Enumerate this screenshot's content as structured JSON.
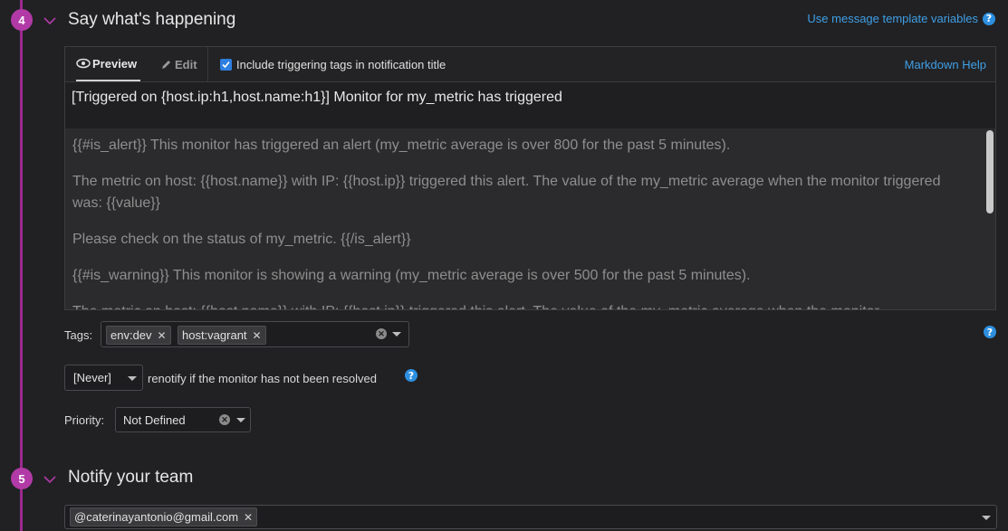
{
  "steps": [
    {
      "number": "4",
      "title": "Say what's happening"
    },
    {
      "number": "5",
      "title": "Notify your team"
    }
  ],
  "template_link": "Use message template variables",
  "editor": {
    "tabs": {
      "preview": "Preview",
      "edit": "Edit"
    },
    "include_tags_label": "Include triggering tags in notification title",
    "include_tags_checked": true,
    "markdown_help": "Markdown Help",
    "title_text": "[Triggered on {host.ip:h1,host.name:h1}] Monitor for my_metric has triggered",
    "body": [
      "{{#is_alert}} This monitor has triggered an alert (my_metric average is over 800 for the past 5 minutes).",
      "The metric on host: {{host.name}} with IP: {{host.ip}} triggered this alert. The value of the my_metric average when the monitor triggered was: {{value}}",
      "Please check on the status of my_metric. {{/is_alert}}",
      "{{#is_warning}} This monitor is showing a warning (my_metric average is over 500 for the past 5 minutes).",
      "The metric on host: {{host.name}} with IP: {{host.ip}} triggered this alert. The value of the my_metric average when the monitor"
    ]
  },
  "tags": {
    "label": "Tags:",
    "items": [
      "env:dev",
      "host:vagrant"
    ]
  },
  "renotify": {
    "value": "[Never]",
    "label": "renotify if the monitor has not been resolved"
  },
  "priority": {
    "label": "Priority:",
    "value": "Not Defined"
  },
  "notify": {
    "recipients": [
      "@caterinayantonio@gmail.com"
    ]
  },
  "help_glyph": "?",
  "remove_glyph": "✕",
  "colors": {
    "accent": "#3f9fe6",
    "step": "#b13aa6",
    "timeline": "#9a2a8f"
  }
}
